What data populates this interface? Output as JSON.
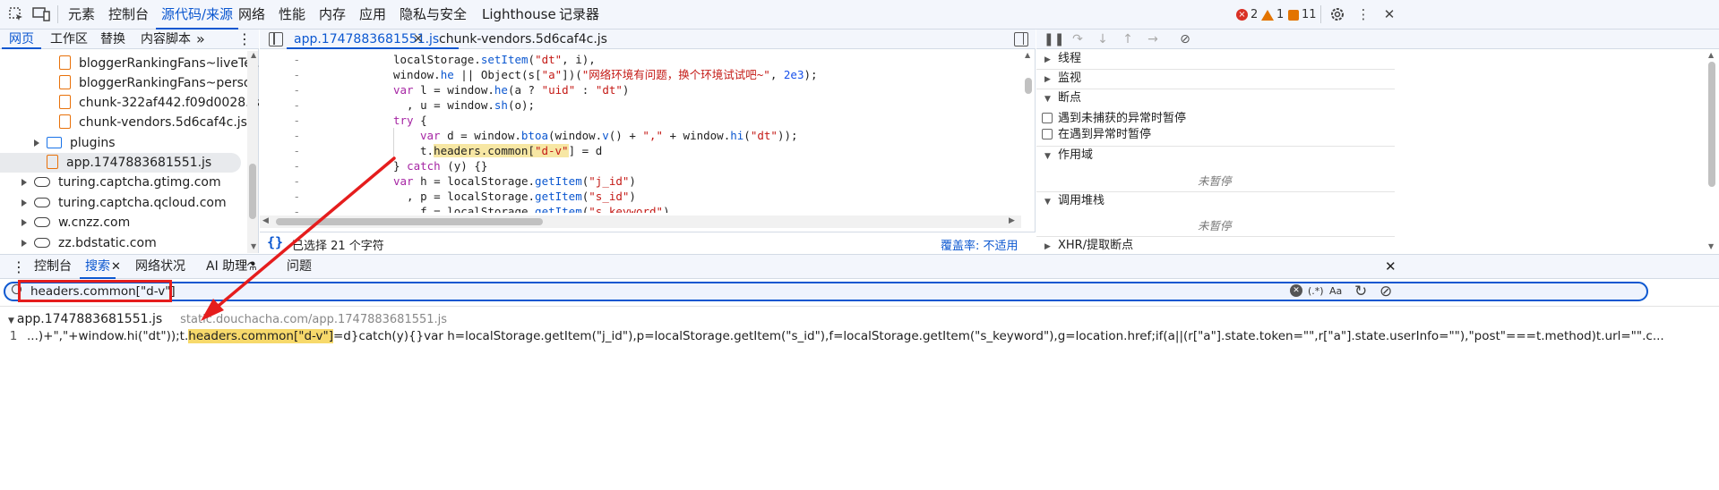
{
  "topbar": {
    "inspect_icon": "inspect-element-icon",
    "device_icon": "device-toolbar-icon",
    "tabs": [
      "元素",
      "控制台",
      "源代码/来源",
      "网络",
      "性能",
      "内存",
      "应用",
      "隐私与安全",
      "Lighthouse",
      "记录器"
    ],
    "active_tab": "源代码/来源",
    "errors": "2",
    "warnings": "1",
    "issues": "11"
  },
  "left": {
    "tabs": [
      "网页",
      "工作区",
      "替换",
      "内容脚本"
    ],
    "more": "»",
    "tree": [
      {
        "label": "bloggerRankingFans~liveTe...",
        "type": "file"
      },
      {
        "label": "bloggerRankingFans~perso...",
        "type": "file"
      },
      {
        "label": "chunk-322af442.f09d0028.js",
        "type": "file"
      },
      {
        "label": "chunk-vendors.5d6caf4c.js",
        "type": "file"
      },
      {
        "label": "plugins",
        "type": "folder"
      },
      {
        "label": "app.1747883681551.js",
        "type": "file"
      },
      {
        "label": "turing.captcha.gtimg.com",
        "type": "domain"
      },
      {
        "label": "turing.captcha.qcloud.com",
        "type": "domain"
      },
      {
        "label": "w.cnzz.com",
        "type": "domain"
      },
      {
        "label": "zz.bdstatic.com",
        "type": "domain"
      }
    ]
  },
  "editor": {
    "tabs": [
      "app.1747883681551.js",
      "chunk-vendors.5d6caf4c.js"
    ],
    "status_selection": "已选择 21 个字符",
    "coverage": "覆盖率: 不适用",
    "pretty_print": "{}",
    "gutter": "-",
    "code": {
      "l1a": "localStorage.",
      "l1b": "setItem",
      "l1c": "(",
      "l1d": "\"dt\"",
      "l1e": ", i),",
      "l2a": "window.",
      "l2b": "he",
      "l2c": " || Object(s[",
      "l2d": "\"a\"",
      "l2e": "])(",
      "l2f": "\"网络环境有问题，换个环境试试吧~\"",
      "l2g": ", ",
      "l2h": "2e3",
      "l2i": ");",
      "l3a": "var",
      "l3b": " l = window.",
      "l3c": "he",
      "l3d": "(a ? ",
      "l3e": "\"uid\"",
      "l3f": " : ",
      "l3g": "\"dt\"",
      "l3h": ")",
      "l4a": "  , u = window.",
      "l4b": "sh",
      "l4c": "(o);",
      "l5a": "try",
      "l5b": " {",
      "l6a": "var",
      "l6b": " d = window.",
      "l6c": "btoa",
      "l6d": "(window.",
      "l6e": "v",
      "l6f": "() + ",
      "l6g": "\",\"",
      "l6h": " + window.",
      "l6i": "hi",
      "l6j": "(",
      "l6k": "\"dt\"",
      "l6l": "));",
      "l7a": "t.",
      "l7b": "headers.common",
      "l7c": "[",
      "l7d": "\"d-v\"",
      "l7e": "] = d",
      "l8a": "} ",
      "l8b": "catch",
      "l8c": " (y) {}",
      "l9a": "var",
      "l9b": " h = localStorage.",
      "l9c": "getItem",
      "l9d": "(",
      "l9e": "\"j_id\"",
      "l9f": ")",
      "l10a": "  , p = localStorage.",
      "l10b": "getItem",
      "l10c": "(",
      "l10d": "\"s_id\"",
      "l10e": ")",
      "l11a": "  , f = localStorage.",
      "l11b": "getItem",
      "l11c": "(",
      "l11d": "\"s_keyword\"",
      "l11e": ")"
    }
  },
  "right": {
    "sections": {
      "threads": "线程",
      "watch": "监视",
      "breakpoints": "断点",
      "pause_uncaught": "遇到未捕获的异常时暂停",
      "pause_caught": "在遇到异常时暂停",
      "scope": "作用域",
      "not_paused_1": "未暂停",
      "call_stack": "调用堆栈",
      "not_paused_2": "未暂停",
      "xhr": "XHR/提取断点"
    }
  },
  "drawer": {
    "tabs": [
      "控制台",
      "搜索",
      "网络状况",
      "AI 助理",
      "问题"
    ],
    "active_tab": "搜索",
    "search_value": "headers.common[\"d-v\"]",
    "regex_label": "(.*)",
    "case_label": "Aa",
    "result": {
      "file": "app.1747883681551.js",
      "url": "static.douchacha.com/app.1747883681551.js",
      "line_no": "1",
      "pre": "...)+\",\"+window.hi(\"dt\"));t.",
      "match": "headers.common[\"d-v\"]",
      "post": "=d}catch(y){}var h=localStorage.getItem(\"j_id\"),p=localStorage.getItem(\"s_id\"),f=localStorage.getItem(\"s_keyword\"),g=location.href;if(a||(r[\"a\"].state.token=\"\",r[\"a\"].state.userInfo=\"\"),\"post\"===t.method)t.url=\"\".c..."
    }
  },
  "colors": {
    "accent": "#0b57d0",
    "annotation": "#e51d1d",
    "error": "#d93025",
    "warning": "#e37400"
  }
}
